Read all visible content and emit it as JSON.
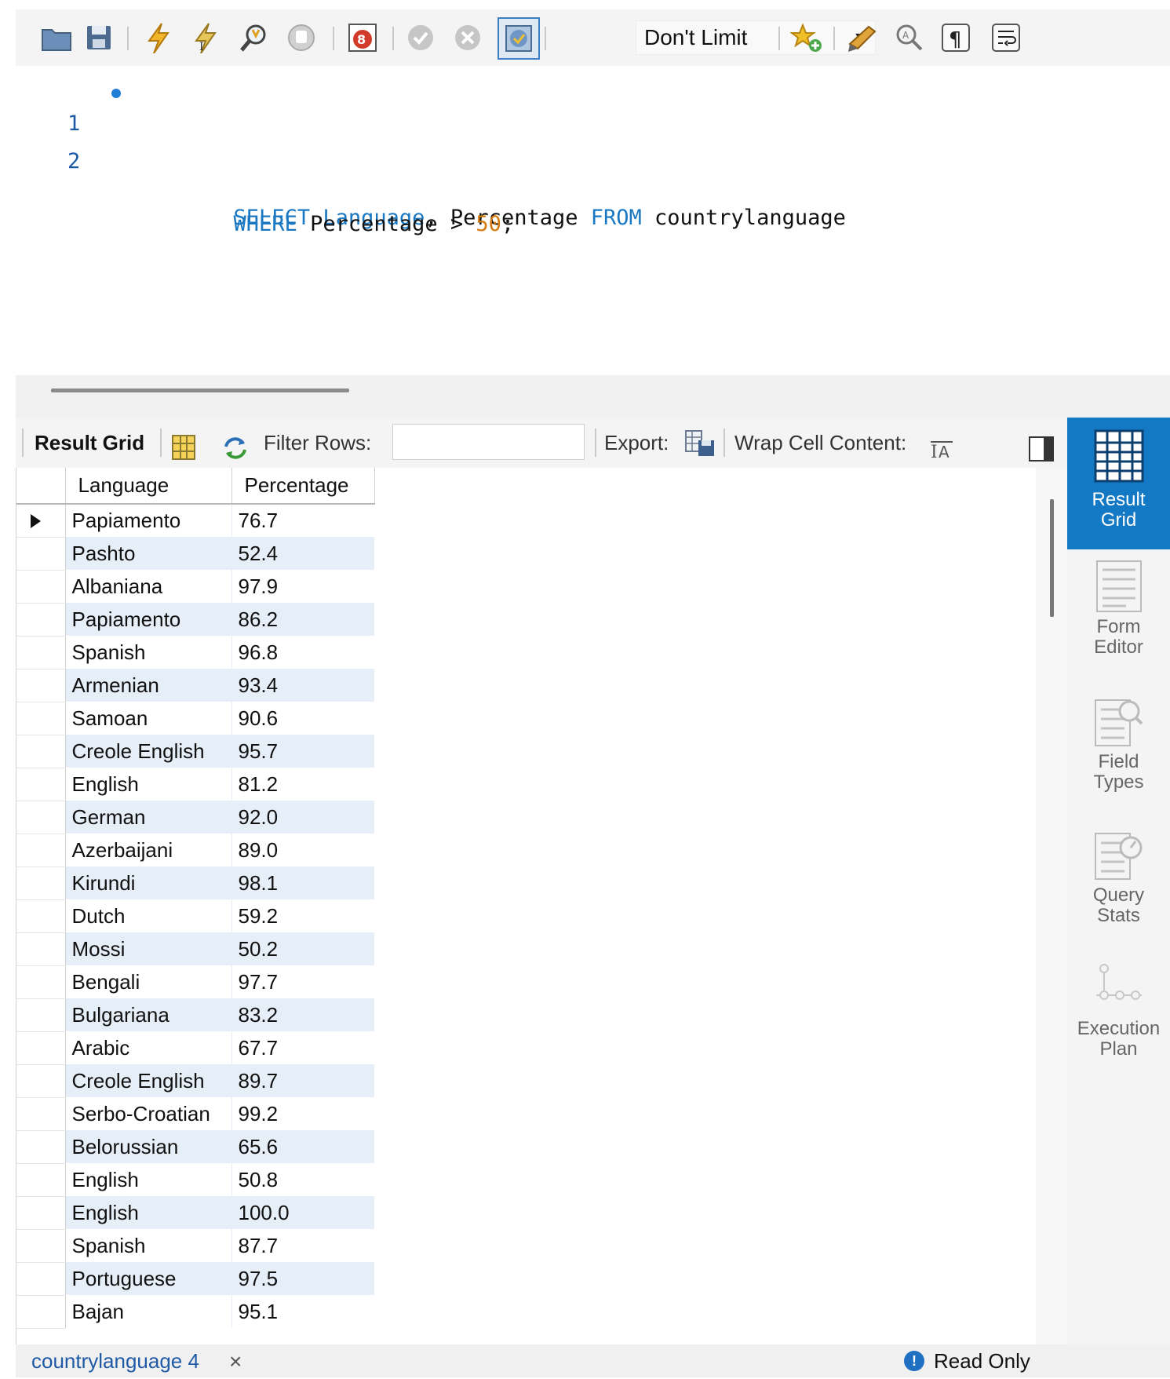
{
  "toolbar": {
    "limit_value": "Don't Limit",
    "icons": [
      "folder-icon",
      "save-icon",
      "execute-icon",
      "execute-current-icon",
      "explain-icon",
      "stop-icon",
      "stop-on-error-icon",
      "commit-icon",
      "rollback-icon",
      "autocommit-icon",
      "beautify-icon",
      "find-icon",
      "invisibles-icon",
      "wrap-icon",
      "snippets-icon"
    ]
  },
  "editor": {
    "lines": [
      {
        "number": "1",
        "tokens": [
          {
            "text": "SELECT",
            "kind": "kw"
          },
          {
            "text": " ",
            "kind": "id"
          },
          {
            "text": "Language",
            "kind": "kw"
          },
          {
            "text": ", Percentage ",
            "kind": "id"
          },
          {
            "text": "FROM",
            "kind": "kw"
          },
          {
            "text": " countrylanguage",
            "kind": "id"
          }
        ]
      },
      {
        "number": "2",
        "tokens": [
          {
            "text": "WHERE",
            "kind": "kw"
          },
          {
            "text": " Percentage > ",
            "kind": "id"
          },
          {
            "text": "50",
            "kind": "num"
          },
          {
            "text": ";",
            "kind": "id"
          }
        ]
      }
    ]
  },
  "result_toolbar": {
    "result_grid_label": "Result Grid",
    "filter_label": "Filter Rows:",
    "filter_value": "",
    "export_label": "Export:",
    "wrap_label": "Wrap Cell Content:"
  },
  "grid": {
    "columns": [
      "Language",
      "Percentage"
    ],
    "rows": [
      [
        "Papiamento",
        "76.7"
      ],
      [
        "Pashto",
        "52.4"
      ],
      [
        "Albaniana",
        "97.9"
      ],
      [
        "Papiamento",
        "86.2"
      ],
      [
        "Spanish",
        "96.8"
      ],
      [
        "Armenian",
        "93.4"
      ],
      [
        "Samoan",
        "90.6"
      ],
      [
        "Creole English",
        "95.7"
      ],
      [
        "English",
        "81.2"
      ],
      [
        "German",
        "92.0"
      ],
      [
        "Azerbaijani",
        "89.0"
      ],
      [
        "Kirundi",
        "98.1"
      ],
      [
        "Dutch",
        "59.2"
      ],
      [
        "Mossi",
        "50.2"
      ],
      [
        "Bengali",
        "97.7"
      ],
      [
        "Bulgariana",
        "83.2"
      ],
      [
        "Arabic",
        "67.7"
      ],
      [
        "Creole English",
        "89.7"
      ],
      [
        "Serbo-Croatian",
        "99.2"
      ],
      [
        "Belorussian",
        "65.6"
      ],
      [
        "English",
        "50.8"
      ],
      [
        "English",
        "100.0"
      ],
      [
        "Spanish",
        "87.7"
      ],
      [
        "Portuguese",
        "97.5"
      ],
      [
        "Bajan",
        "95.1"
      ]
    ]
  },
  "side_panel": {
    "items": [
      {
        "label_1": "Result",
        "label_2": "Grid",
        "icon": "result-grid-icon",
        "active": true
      },
      {
        "label_1": "Form",
        "label_2": "Editor",
        "icon": "form-editor-icon",
        "active": false
      },
      {
        "label_1": "Field",
        "label_2": "Types",
        "icon": "field-types-icon",
        "active": false
      },
      {
        "label_1": "Query",
        "label_2": "Stats",
        "icon": "query-stats-icon",
        "active": false
      },
      {
        "label_1": "Execution",
        "label_2": "Plan",
        "icon": "execution-plan-icon",
        "active": false
      }
    ]
  },
  "status": {
    "tab_label": "countrylanguage 4",
    "close_glyph": "×",
    "read_only": "Read Only",
    "info_glyph": "!"
  },
  "colors": {
    "accent": "#1479c4",
    "keyword": "#1a78c2",
    "number": "#d47a0e",
    "row_alt": "#e6eef8"
  }
}
